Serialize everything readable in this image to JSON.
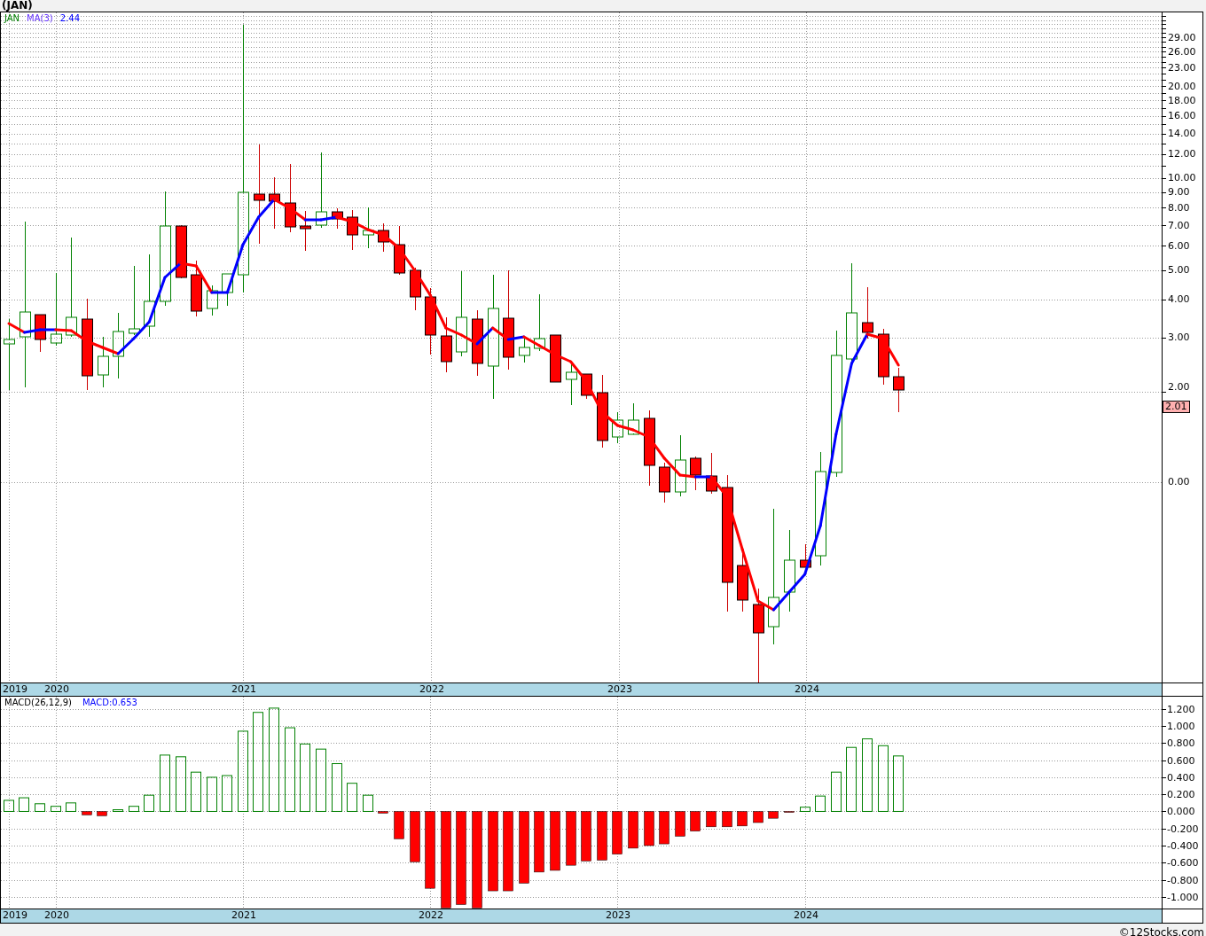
{
  "title": "(JAN)",
  "price_panel": {
    "legend": [
      {
        "kind": "symbol",
        "text": "JAN"
      },
      {
        "kind": "indicator",
        "text": "MA(3)"
      },
      {
        "kind": "value",
        "text": "2.44"
      }
    ],
    "axis_labels": [
      "29.00",
      "26.00",
      "23.00",
      "20.00",
      "18.00",
      "16.00",
      "14.00",
      "12.00",
      "10.00",
      "9.00",
      "8.00",
      "7.00",
      "6.00",
      "5.00",
      "4.00",
      "3.00",
      "2.00",
      "0.00"
    ],
    "last_price": "2.01"
  },
  "price_x_axis": [
    "2019",
    "2020",
    "2021",
    "2022",
    "2023",
    "2024"
  ],
  "macd_panel": {
    "x_axis_start_label": "2019",
    "legend": [
      {
        "kind": "indicator",
        "text": "MACD(26,12,9)"
      },
      {
        "kind": "value",
        "text": "MACD:0.653"
      }
    ],
    "chart_data": {
      "type": "bar",
      "grid": true,
      "ylim": [
        -1.137,
        1.344
      ],
      "xlim": [
        2019.708,
        2026.132
      ],
      "x": [
        2019.75,
        2019.833,
        2019.917,
        2020,
        2020.083,
        2020.167,
        2020.25,
        2020.333,
        2020.417,
        2020.5,
        2020.583,
        2020.667,
        2020.75,
        2020.833,
        2020.917,
        2021,
        2021.083,
        2021.167,
        2021.25,
        2021.333,
        2021.417,
        2021.5,
        2021.583,
        2021.667,
        2021.75,
        2021.833,
        2021.917,
        2022,
        2022.083,
        2022.167,
        2022.25,
        2022.333,
        2022.417,
        2022.5,
        2022.583,
        2022.667,
        2022.75,
        2022.833,
        2022.917,
        2023,
        2023.083,
        2023.167,
        2023.25,
        2023.333,
        2023.417,
        2023.5,
        2023.583,
        2023.667,
        2023.75,
        2023.833,
        2023.917,
        2024,
        2024.083,
        2024.167,
        2024.25,
        2024.333,
        2024.417,
        2024.5
      ],
      "xticks": [
        {
          "value": 2020,
          "label": "2020"
        },
        {
          "value": 2021,
          "label": "2021"
        },
        {
          "value": 2022,
          "label": "2022"
        },
        {
          "value": 2023,
          "label": "2023"
        },
        {
          "value": 2024,
          "label": "2024"
        }
      ],
      "yticks": [
        {
          "value": 1.2,
          "label": "1.200"
        },
        {
          "value": 1,
          "label": "1.000"
        },
        {
          "value": 0.8,
          "label": "0.800"
        },
        {
          "value": 0.6,
          "label": "0.600"
        },
        {
          "value": 0.4,
          "label": "0.400"
        },
        {
          "value": 0.2,
          "label": "0.200"
        },
        {
          "value": 0,
          "label": "0.000"
        },
        {
          "value": -0.2,
          "label": "-0.200"
        },
        {
          "value": -0.4,
          "label": "-0.400"
        },
        {
          "value": -0.6,
          "label": "-0.600"
        },
        {
          "value": -0.8,
          "label": "-0.800"
        },
        {
          "value": -1,
          "label": "-1.000"
        }
      ],
      "series": [
        {
          "color": "#008000",
          "values": [
            0.13,
            0.16,
            0.09,
            0.06,
            0.1,
            null,
            null,
            0.02,
            0.06,
            0.19,
            0.66,
            0.64,
            0.46,
            0.4,
            0.42,
            0.94,
            1.16,
            1.21,
            0.98,
            0.79,
            0.73,
            0.56,
            0.33,
            0.19,
            null,
            null,
            null,
            null,
            null,
            null,
            null,
            null,
            null,
            null,
            null,
            null,
            null,
            null,
            null,
            null,
            null,
            null,
            null,
            null,
            null,
            null,
            null,
            null,
            null,
            null,
            null,
            0.05,
            0.18,
            0.46,
            0.75,
            0.85,
            0.77,
            0.65
          ]
        },
        {
          "color": "#ff0000",
          "values": [
            null,
            null,
            null,
            null,
            null,
            -0.04,
            -0.05,
            null,
            null,
            null,
            null,
            null,
            null,
            null,
            null,
            null,
            null,
            null,
            null,
            null,
            null,
            null,
            null,
            null,
            -0.02,
            -0.32,
            -0.59,
            -0.9,
            -1.13,
            -1.09,
            -1.13,
            -0.93,
            -0.93,
            -0.84,
            -0.71,
            -0.69,
            -0.63,
            -0.58,
            -0.57,
            -0.5,
            -0.43,
            -0.4,
            -0.38,
            -0.29,
            -0.23,
            -0.18,
            -0.18,
            -0.17,
            -0.13,
            -0.08,
            -0.01,
            null,
            null,
            null,
            null,
            null,
            null,
            null
          ]
        }
      ]
    }
  },
  "footer": "©12Stocks.com"
}
